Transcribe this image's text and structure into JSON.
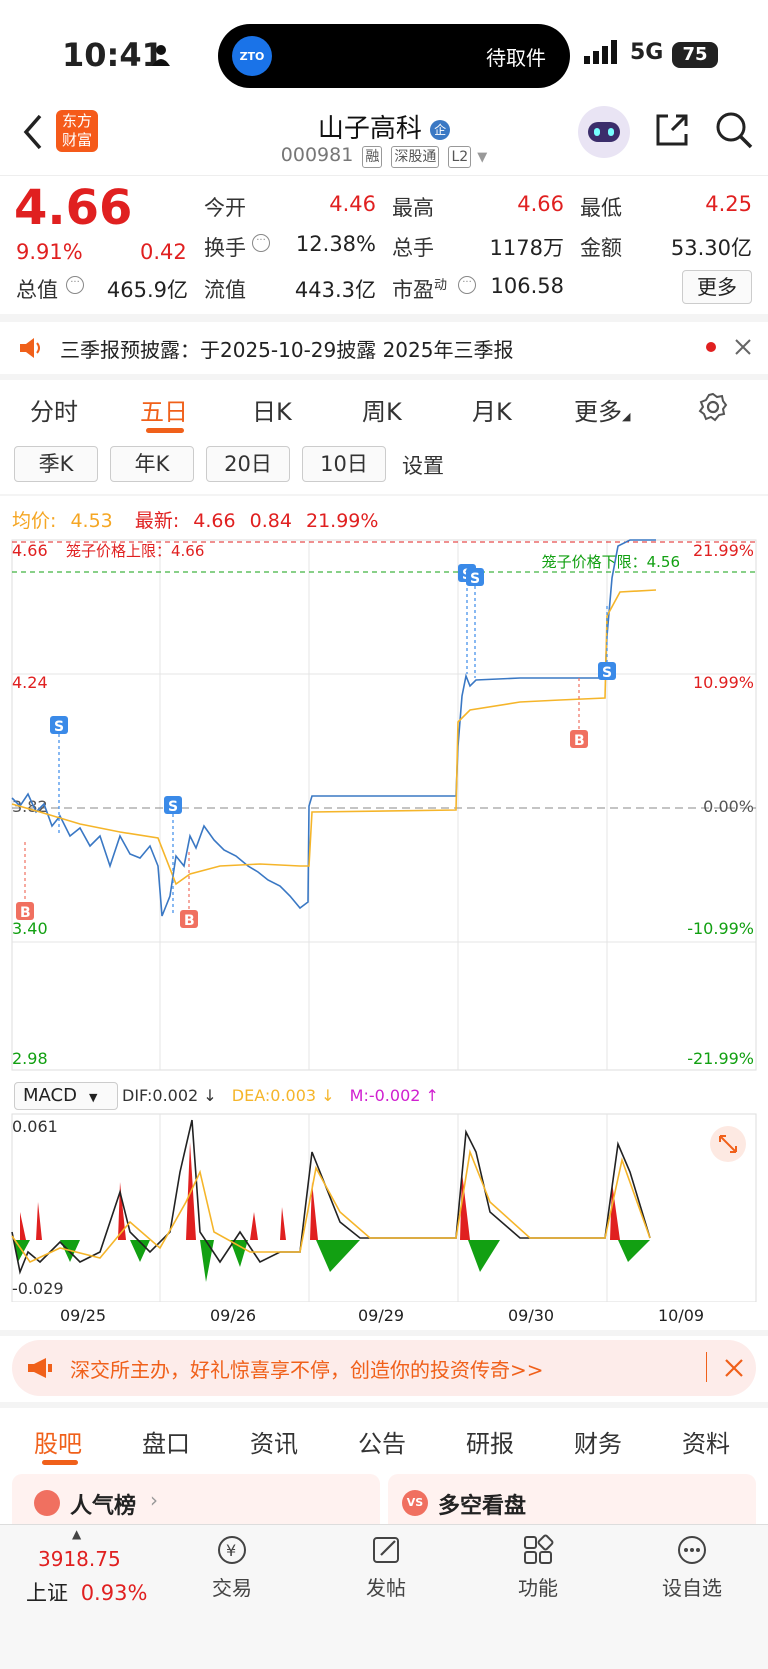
{
  "status": {
    "time": "10:41",
    "island_logo": "ZTO",
    "island_text": "待取件",
    "network": "5G",
    "battery": "75"
  },
  "header": {
    "title": "山子高科",
    "title_badge": "企",
    "code": "000981",
    "tags": [
      "融",
      "深股通",
      "L2"
    ]
  },
  "logo": {
    "line1": "东方",
    "line2": "财富"
  },
  "quote": {
    "price": "4.66",
    "change_pct": "9.91%",
    "change": "0.42",
    "open_label": "今开",
    "open": "4.46",
    "high_label": "最高",
    "high": "4.66",
    "low_label": "最低",
    "low": "4.25",
    "turnover_label": "换手",
    "turnover": "12.38%",
    "volume_label": "总手",
    "volume": "1178万",
    "amount_label": "金额",
    "amount": "53.30亿",
    "mktcap_label": "总值",
    "mktcap": "465.9亿",
    "float_label": "流值",
    "float": "443.3亿",
    "pe_label": "市盈",
    "pe_sup": "动",
    "pe": "106.58",
    "more": "更多"
  },
  "notice": {
    "text": "三季报预披露：于2025-10-29披露 2025年三季报"
  },
  "tabs": [
    "分时",
    "五日",
    "日K",
    "周K",
    "月K",
    "更多"
  ],
  "active_tab": "五日",
  "chips": [
    "季K",
    "年K",
    "20日",
    "10日"
  ],
  "chip_setting": "设置",
  "summary": {
    "avg_label": "均价:",
    "avg": "4.53",
    "last_label": "最新:",
    "last": "4.66",
    "chg": "0.84",
    "pct": "21.99%"
  },
  "chart": {
    "y_left": [
      "4.66",
      "4.24",
      "3.82",
      "3.40",
      "2.98"
    ],
    "y_right": [
      "21.99%",
      "10.99%",
      "0.00%",
      "-10.99%",
      "-21.99%"
    ],
    "upper_limit": "笼子价格上限：4.66",
    "lower_limit": "笼子价格下限：4.56",
    "dates": [
      "09/25",
      "09/26",
      "09/29",
      "09/30",
      "10/09"
    ],
    "colors": {
      "price": "#3a78c4",
      "avg": "#f5b52a",
      "up": "#e02020",
      "down": "#12a012"
    }
  },
  "macd": {
    "name": "MACD",
    "dif": "DIF:0.002 ↓",
    "dea": "DEA:0.003 ↓",
    "m": "M:-0.002 ↑",
    "max": "0.061",
    "min": "-0.029"
  },
  "ad": {
    "text": "深交所主办，好礼惊喜享不停，创造你的投资传奇>>"
  },
  "bottom_tabs": [
    "股吧",
    "盘口",
    "资讯",
    "公告",
    "研报",
    "财务",
    "资料"
  ],
  "cards": [
    {
      "title": "人气榜"
    },
    {
      "title": "多空看盘"
    }
  ],
  "index": {
    "value": "3918.75",
    "name": "上证",
    "pct": "0.93%"
  },
  "nav": [
    "交易",
    "发帖",
    "功能",
    "设自选"
  ]
}
